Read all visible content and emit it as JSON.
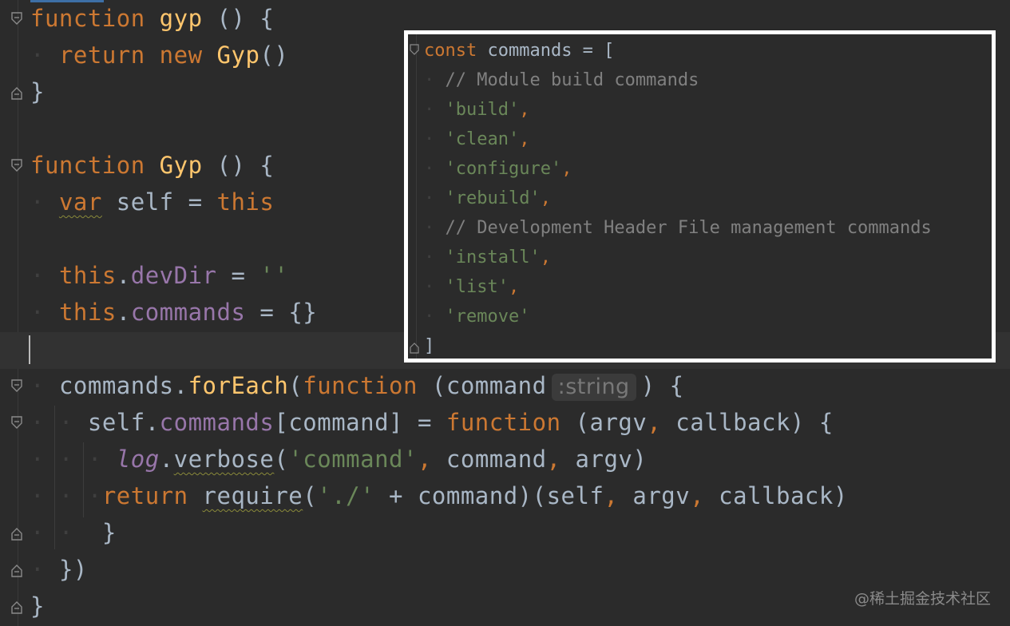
{
  "editor": {
    "l1": {
      "kw": "function",
      "name": "gyp",
      "rest": " () {"
    },
    "l2": {
      "kw1": "return",
      "kw2": "new",
      "name": "Gyp",
      "rest": "()"
    },
    "l3": "}",
    "l5": {
      "kw": "function",
      "name": "Gyp",
      "rest": " () {"
    },
    "l6": {
      "kw": "var",
      "rest": " self = ",
      "this": "this"
    },
    "l8": {
      "this": "this",
      "dot": ".",
      "prop": "devDir",
      "eq": " = ",
      "str": "''"
    },
    "l9": {
      "this": "this",
      "dot": ".",
      "prop": "commands",
      "rest": " = {}"
    },
    "l11": {
      "obj": "commands.",
      "fn": "forEach",
      "p1": "(",
      "kw": "function",
      "p2": " (command",
      "hint": ":string",
      "p3": ") {"
    },
    "l12": {
      "obj": "self.",
      "prop": "commands",
      "p1": "[command] = ",
      "kw": "function",
      "p2": " (argv",
      "comma": ",",
      "p3": " callback) {"
    },
    "l13": {
      "log": "log",
      "dot": ".",
      "verbose": "verbose",
      "p1": "(",
      "str": "'command'",
      "comma": ",",
      "p2": " command",
      "comma2": ",",
      "p3": " argv)"
    },
    "l14": {
      "kw": "return",
      "sp": " ",
      "req": "require",
      "p1": "(",
      "str": "'./'",
      "p2": " + command)(self",
      "c1": ",",
      "p3": " argv",
      "c2": ",",
      "p4": " callback)"
    },
    "l15": "}",
    "l16": "})",
    "l17": "}"
  },
  "overlay": {
    "o1": {
      "kw": "const",
      "rest": " commands = ["
    },
    "o2": "// Module build commands",
    "o3": "'build'",
    "o4": "'clean'",
    "o5": "'configure'",
    "o6": "'rebuild'",
    "o7": "// Development Header File management commands",
    "o8": "'install'",
    "o9": "'list'",
    "o10": "'remove'",
    "o11": "]",
    "comma": ","
  },
  "watermark": "@稀土掘金技术社区",
  "colors": {
    "background": "#2b2b2b",
    "keyword": "#cc7832",
    "function_name": "#ffc66d",
    "property": "#9876aa",
    "string": "#6a8759",
    "comment": "#808080",
    "text": "#a9b7c6"
  }
}
